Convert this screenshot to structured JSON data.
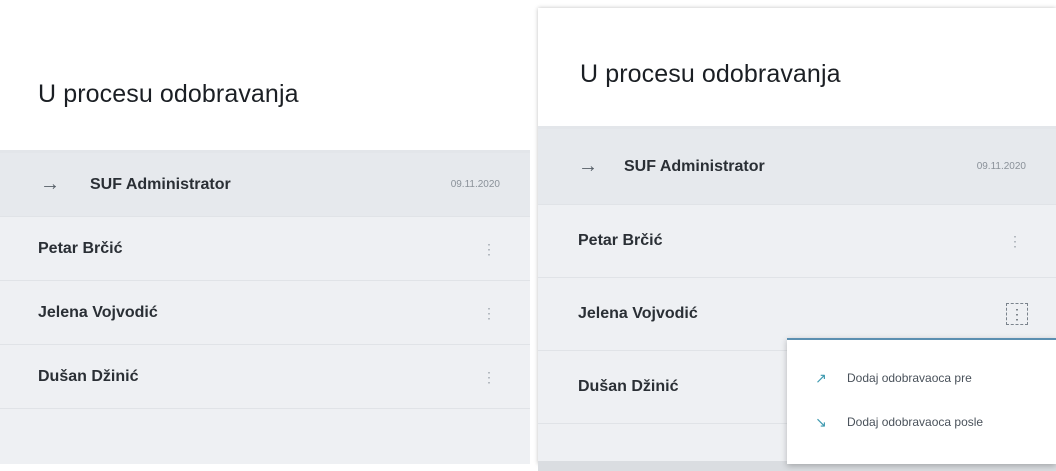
{
  "left_panel": {
    "title": "U procesu odobravanja",
    "rows": [
      {
        "name": "SUF Administrator",
        "date": "09.11.2020",
        "icon": "arrow-right-icon"
      },
      {
        "name": "Petar Brčić",
        "icon": "more-vertical-icon"
      },
      {
        "name": "Jelena Vojvodić",
        "icon": "more-vertical-icon"
      },
      {
        "name": "Dušan Džinić",
        "icon": "more-vertical-icon"
      }
    ]
  },
  "right_panel": {
    "title": "U procesu odobravanja",
    "rows": [
      {
        "name": "SUF Administrator",
        "date": "09.11.2020",
        "icon": "arrow-right-icon"
      },
      {
        "name": "Petar Brčić",
        "icon": "more-vertical-icon"
      },
      {
        "name": "Jelena Vojvodić",
        "icon": "more-vertical-icon"
      },
      {
        "name": "Dušan Džinić"
      }
    ]
  },
  "context_menu": {
    "items": [
      {
        "label": "Dodaj odobravaoca pre",
        "icon": "arrow-up-right-icon"
      },
      {
        "label": "Dodaj odobravaoca posle",
        "icon": "arrow-down-right-icon"
      }
    ]
  },
  "colors": {
    "row_background": "#eef0f3",
    "accent": "#3f9ab0",
    "menu_border": "#5b8fb0"
  }
}
